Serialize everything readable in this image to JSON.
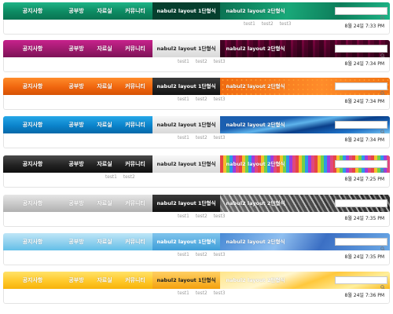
{
  "menu": [
    "공지사항",
    "공부방",
    "자료실",
    "커뮤니티"
  ],
  "layout1": "nabul2 layout 1단형식",
  "layout2": "nabul2 layout 2단형식",
  "subs": [
    "test1",
    "test2",
    "test3"
  ],
  "subs_short": [
    "test1",
    "test2"
  ],
  "search_placeholder": "",
  "bars": [
    {
      "theme": "green",
      "date": "8월 24일  7:33 PM"
    },
    {
      "theme": "magenta",
      "date": "8월 24일  7:34 PM"
    },
    {
      "theme": "orange",
      "date": "8월 24일  7:34 PM"
    },
    {
      "theme": "blue",
      "date": "8월 24일  7:34 PM"
    },
    {
      "theme": "black",
      "date": "8월 24일  7:25 PM"
    },
    {
      "theme": "silver",
      "date": "8월 24일  7:35 PM"
    },
    {
      "theme": "sky",
      "date": "8월 24일  7:35 PM"
    },
    {
      "theme": "yellow",
      "date": "8월 24일  7:36 PM"
    }
  ],
  "icons": {
    "search": "search-icon"
  }
}
